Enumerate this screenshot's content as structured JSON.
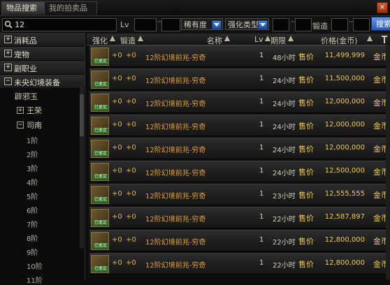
{
  "tabs": [
    "物品搜索",
    "我的拍卖品"
  ],
  "close_label": "×",
  "search": {
    "query": "12",
    "lv_label": "Lv",
    "tilde": "~",
    "rarity_label": "稀有度",
    "enhance_type_label": "强化类型",
    "lock_label": "锻造",
    "button_label": "搜索"
  },
  "tree": {
    "categories": [
      {
        "box": "+",
        "label": "消耗品"
      },
      {
        "box": "+",
        "label": "宠物"
      },
      {
        "box": "+",
        "label": "副职业"
      },
      {
        "box": "−",
        "label": "未央幻境装备"
      }
    ],
    "group_label": "辟邪玉",
    "subs": [
      {
        "box": "+",
        "label": "王荣"
      },
      {
        "box": "−",
        "label": "司南"
      }
    ],
    "tiers": [
      "1阶",
      "2阶",
      "3阶",
      "4阶",
      "5阶",
      "6阶",
      "7阶",
      "8阶",
      "9阶",
      "10阶",
      "11阶"
    ]
  },
  "table": {
    "columns": [
      "强化",
      "锻造",
      "名称",
      "Lv",
      "期限",
      "价格(金币)"
    ],
    "sell_label": "售价",
    "currency_label": "金币",
    "icon_tag": "已鉴定",
    "rows": [
      {
        "enhance": "+0",
        "lock": "+0",
        "name": "12阶幻境前兆-穷奇",
        "lv": "1",
        "time": "48小时",
        "price": "11,499,999"
      },
      {
        "enhance": "+0",
        "lock": "+0",
        "name": "12阶幻境前兆-穷奇",
        "lv": "1",
        "time": "24小时",
        "price": "11,500,000"
      },
      {
        "enhance": "+0",
        "lock": "+0",
        "name": "12阶幻境前兆-穷奇",
        "lv": "1",
        "time": "24小时",
        "price": "12,000,000"
      },
      {
        "enhance": "+0",
        "lock": "+0",
        "name": "12阶幻境前兆-穷奇",
        "lv": "1",
        "time": "24小时",
        "price": "12,000,000"
      },
      {
        "enhance": "+0",
        "lock": "+0",
        "name": "12阶幻境前兆-穷奇",
        "lv": "1",
        "time": "24小时",
        "price": "12,000,000"
      },
      {
        "enhance": "+0",
        "lock": "+0",
        "name": "12阶幻境前兆-穷奇",
        "lv": "1",
        "time": "24小时",
        "price": "12,500,000"
      },
      {
        "enhance": "+0",
        "lock": "+0",
        "name": "12阶幻境前兆-穷奇",
        "lv": "1",
        "time": "23小时",
        "price": "12,555,555"
      },
      {
        "enhance": "+0",
        "lock": "+0",
        "name": "12阶幻境前兆-穷奇",
        "lv": "1",
        "time": "22小时",
        "price": "12,587,897"
      },
      {
        "enhance": "+0",
        "lock": "+0",
        "name": "12阶幻境前兆-穷奇",
        "lv": "1",
        "time": "22小时",
        "price": "12,800,000"
      },
      {
        "enhance": "+0",
        "lock": "+0",
        "name": "12阶幻境前兆-穷奇",
        "lv": "1",
        "time": "22小时",
        "price": "12,800,000"
      }
    ]
  },
  "colors": {
    "gold_text": "#f0c75a",
    "name_text": "#e8a13c",
    "button_blue": "#2a56b5"
  }
}
